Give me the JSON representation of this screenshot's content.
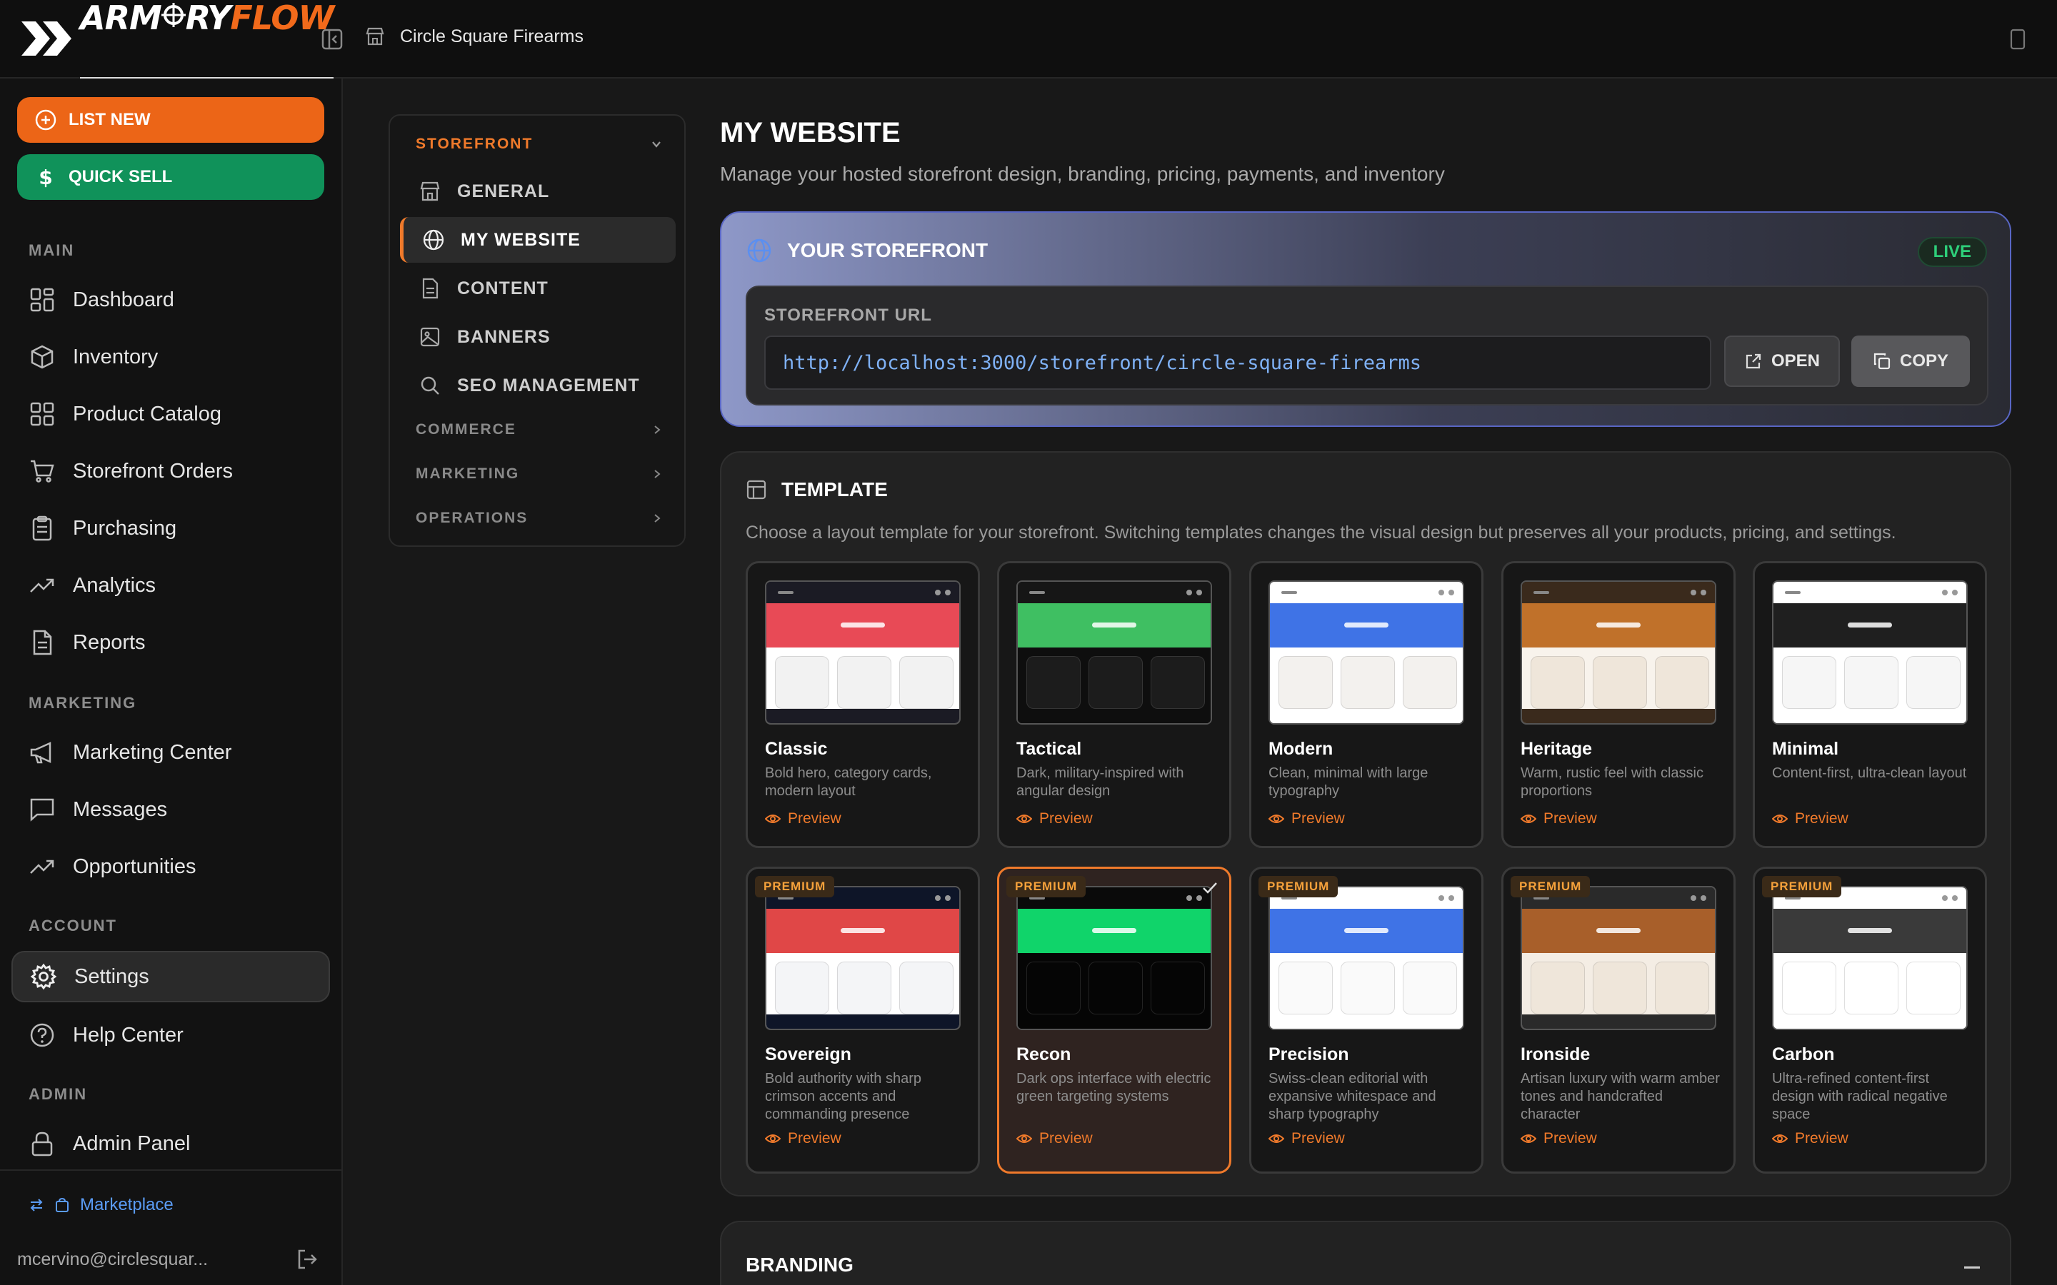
{
  "logo": {
    "part1": "ARM",
    "part2": "RY",
    "part3": "FLOW",
    "crosshair": "crosshair-o"
  },
  "header": {
    "store_name": "Circle Square Firearms"
  },
  "sidebar": {
    "list_new": "LIST NEW",
    "quick_sell": "QUICK SELL",
    "sections": {
      "main": "MAIN",
      "marketing": "MARKETING",
      "account": "ACCOUNT",
      "admin": "ADMIN"
    },
    "items": {
      "dashboard": "Dashboard",
      "inventory": "Inventory",
      "catalog": "Product Catalog",
      "orders": "Storefront Orders",
      "purchasing": "Purchasing",
      "analytics": "Analytics",
      "reports": "Reports",
      "marketing_center": "Marketing Center",
      "messages": "Messages",
      "opportunities": "Opportunities",
      "settings": "Settings",
      "help": "Help Center",
      "admin_panel": "Admin Panel"
    },
    "marketplace": "Marketplace",
    "user_email": "mcervino@circlesquar..."
  },
  "subnav": {
    "storefront": "STOREFRONT",
    "general": "GENERAL",
    "my_website": "MY WEBSITE",
    "content": "CONTENT",
    "banners": "BANNERS",
    "seo": "SEO MANAGEMENT",
    "commerce": "COMMERCE",
    "marketing": "MARKETING",
    "operations": "OPERATIONS"
  },
  "page": {
    "title": "MY WEBSITE",
    "subtitle": "Manage your hosted storefront design, branding, pricing, payments, and inventory"
  },
  "storefront": {
    "heading": "YOUR STOREFRONT",
    "status": "LIVE",
    "url_label": "STOREFRONT URL",
    "url": "http://localhost:3000/storefront/circle-square-firearms",
    "open": "OPEN",
    "copy": "COPY"
  },
  "template": {
    "heading": "TEMPLATE",
    "description": "Choose a layout template for your storefront. Switching templates changes the visual design but preserves all your products, pricing, and settings.",
    "preview_label": "Preview",
    "premium_label": "PREMIUM",
    "items": [
      {
        "name": "Classic",
        "desc": "Bold hero, category cards, modern layout",
        "premium": false,
        "selected": false,
        "bar": "#1b1b24",
        "hero": "#e84a56",
        "body": "#ffffff",
        "cell": "#f2f2f2",
        "foot": "#1b1b24"
      },
      {
        "name": "Tactical",
        "desc": "Dark, military-inspired with angular design",
        "premium": false,
        "selected": false,
        "bar": "#161616",
        "hero": "#3fbf62",
        "body": "#0e0e0e",
        "cell": "#1c1c1c",
        "foot": "#0e0e0e"
      },
      {
        "name": "Modern",
        "desc": "Clean, minimal with large typography",
        "premium": false,
        "selected": false,
        "bar": "#ffffff",
        "hero": "#3f73e6",
        "body": "#ffffff",
        "cell": "#f3f1ee",
        "foot": "#ffffff"
      },
      {
        "name": "Heritage",
        "desc": "Warm, rustic feel with classic proportions",
        "premium": false,
        "selected": false,
        "bar": "#3a2a1c",
        "hero": "#c0712a",
        "body": "#f8f3ec",
        "cell": "#efe6da",
        "foot": "#3a2a1c"
      },
      {
        "name": "Minimal",
        "desc": "Content-first, ultra-clean layout",
        "premium": false,
        "selected": false,
        "bar": "#ffffff",
        "hero": "#1f1f1f",
        "body": "#ffffff",
        "cell": "#f6f6f6",
        "foot": "#ffffff"
      },
      {
        "name": "Sovereign",
        "desc": "Bold authority with sharp crimson accents and commanding presence",
        "premium": true,
        "selected": false,
        "bar": "#0e1528",
        "hero": "#e04747",
        "body": "#ffffff",
        "cell": "#f4f5f7",
        "foot": "#0e1528"
      },
      {
        "name": "Recon",
        "desc": "Dark ops interface with electric green targeting systems",
        "premium": true,
        "selected": true,
        "bar": "#0a0a0a",
        "hero": "#10d46a",
        "body": "#050505",
        "cell": "#050505",
        "foot": "#050505"
      },
      {
        "name": "Precision",
        "desc": "Swiss-clean editorial with expansive whitespace and sharp typography",
        "premium": true,
        "selected": false,
        "bar": "#ffffff",
        "hero": "#3f73e6",
        "body": "#ffffff",
        "cell": "#fafafa",
        "foot": "#ffffff"
      },
      {
        "name": "Ironside",
        "desc": "Artisan luxury with warm amber tones and handcrafted character",
        "premium": true,
        "selected": false,
        "bar": "#2a2a2a",
        "hero": "#a85f2a",
        "body": "#f4ede4",
        "cell": "#efe6da",
        "foot": "#2a2a2a"
      },
      {
        "name": "Carbon",
        "desc": "Ultra-refined content-first design with radical negative space",
        "premium": true,
        "selected": false,
        "bar": "#ffffff",
        "hero": "#3a3a3a",
        "body": "#ffffff",
        "cell": "#ffffff",
        "foot": "#ffffff"
      }
    ]
  },
  "branding": {
    "heading": "BRANDING"
  },
  "colors": {
    "accent": "#f07a2b",
    "list_new": "#ec6517",
    "quick_sell": "#10925a",
    "live": "#2ecf7a",
    "link": "#5b9cf5"
  }
}
